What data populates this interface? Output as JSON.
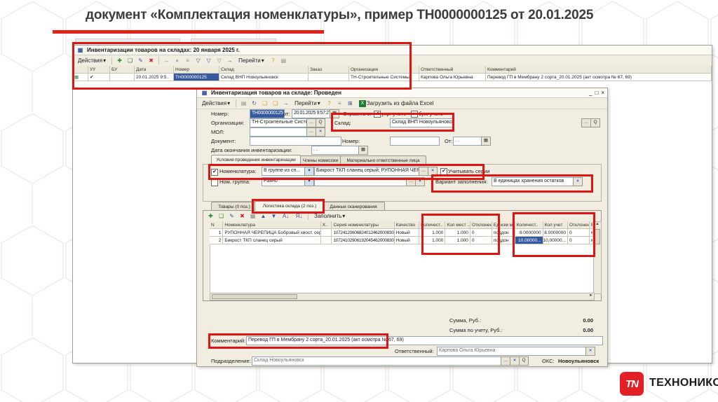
{
  "slide": {
    "title": "документ «Комплектация номенклатуры», пример ТН0000000125 от 20.01.2025"
  },
  "logo": {
    "tn": "TN",
    "text": "ТЕХНОНИКОЛЬ"
  },
  "icons": {
    "caret": "▾",
    "doc": "▦",
    "add": "✚",
    "copy": "❏",
    "edit": "✎",
    "delete": "✖",
    "resize": "↔",
    "find": "⌕",
    "list": "≡",
    "filter": "▽",
    "go": "→",
    "help": "?",
    "print": "▤",
    "reread": "↻",
    "excel": "X",
    "calendar": "▦",
    "dots": "…",
    "clear": "×",
    "search": "Q",
    "check": "✔",
    "up": "▲",
    "down": "▼",
    "sort_asc": "А↓",
    "sort_desc": "Я↓",
    "minimize": "_",
    "maximize": "□",
    "close": "×",
    "left": "◄",
    "right": "►",
    "struct": "⊞"
  },
  "list_window": {
    "title": "Инвентаризации товаров на складах: 20 января 2025 г.",
    "actions_label": "Действия",
    "go_label": "Перейти",
    "columns": [
      "УУ",
      "БУ",
      "Дата",
      "Номер",
      "Склад",
      "Заказ",
      "Организация",
      "Ответственный",
      "Комментарий"
    ],
    "row": {
      "uu": "✔",
      "bu": "",
      "date": "20.01.2025 9:5..",
      "number": "ТН0000000125",
      "warehouse": "Склад ВНП Новоульяновск",
      "order": "",
      "org": "ТН-Строительные Системы",
      "responsible": "Карпова Ольга Юрьевна",
      "comment": "Перевод ГП в Мембрану 2 сорта_20.01.2025 (акт осмотра № 67, 69)"
    }
  },
  "doc_window": {
    "title": "Инвентаризация товаров на складе: Проведен",
    "actions_label": "Действия",
    "go_label": "Перейти",
    "excel_label": "Загрузить из файла Excel",
    "number_label": "Номер:",
    "number_value": "ТН0000000125",
    "date_label": "от:",
    "date_value": "20.01.2025 9:57:27",
    "reflect_label": "Отразить в:",
    "mgmt_check_label": "упр. учете",
    "acc_check_label": "бух. учете",
    "org_label": "Организация:",
    "org_value": "ТН-Строительные Системы",
    "warehouse_label": "Склад:",
    "warehouse_value": "Склад ВНП Новоульяновск",
    "mol_label": "МОЛ:",
    "document_label": "Документ:",
    "doc_number_label": "Номер:",
    "doc_from_label": "От:",
    "doc_from_value": ". .",
    "end_date_label": "Дата окончания инвентаризации:",
    "end_date_value": ". .",
    "section_tabs": [
      "Условия проведения инвентаризации",
      "Члены комиссии",
      "Материально ответственные лица"
    ],
    "nomenclature_check_label": "Номенклатура:",
    "nomenclature_cond": "В группе из сп...",
    "nomenclature_value": "Бикрост ТКП сланец серый; РУПОННАЯ ЧЕРЕПИЦА Бобровы...",
    "series_check_label": "Учитывать серии",
    "group_check_label": "Ном. группа:",
    "group_cond": "Равно",
    "group_value": "",
    "fill_variant_label": "Вариант заполнения:",
    "fill_variant_value": "В единицах хранения остатков",
    "tabs": [
      "Товары (0 поз.)",
      "Логистика склада (2 поз.)",
      "Данные сканирования"
    ],
    "fill_button_label": "Заполнить",
    "table": {
      "columns": [
        "N",
        "Номенклатура",
        "Х..",
        "Серия номенклатуры",
        "Качество",
        "Количест..",
        "Кол мест ..",
        "Отклонен..",
        "Ед изм м..",
        "Количест..",
        "Кол учет",
        "Отклонен..",
        "Е.."
      ],
      "rows": [
        [
          "1",
          "РУПОННАЯ ЧЕРЕПИЦА Бобровый хвост. серая",
          "",
          "10724120606824012462000830",
          "Новый",
          "1.000",
          "1.000",
          "0",
          "поддон",
          "8.0000000",
          "8.0000000",
          "0",
          "м"
        ],
        [
          "2",
          "Бикрост ТКП сланец серый",
          "",
          "10724102906192045462000830",
          "Новый",
          "1.000",
          "1.000",
          "0",
          "поддон",
          "10,00000...",
          "10,00000...",
          "0",
          "м"
        ]
      ]
    },
    "sum_label": "Сумма, Руб.:",
    "sum_value": "0.00",
    "sum_acc_label": "Сумма по учету, Руб.:",
    "sum_acc_value": "0.00",
    "comment_label": "Комментарий:",
    "comment_value": "Перевод ГП в Мембрану 2 сорта_20.01.2025 (акт осмотра № 67, 69)",
    "responsible_label": "Ответственный:",
    "responsible_value": "Карпова Ольга Юрьевна",
    "department_label": "Подразделение:",
    "department_value": "Склад Новоульяновск",
    "oks_label": "ОКС:",
    "oks_value": "Новоульяновск"
  }
}
